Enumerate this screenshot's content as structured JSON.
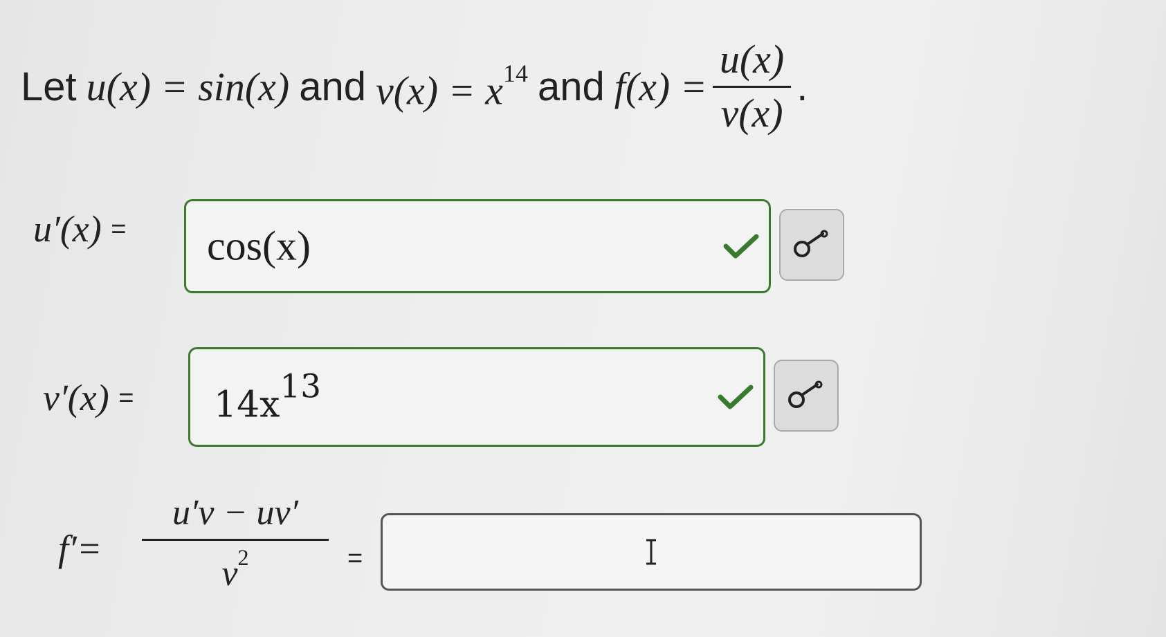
{
  "problem": {
    "let": "Let",
    "and1": "and",
    "and2": "and",
    "u_def": "u(x) = sin(x)",
    "v_def": "v(x) = x",
    "v_exponent": "14",
    "f_lhs": "f(x) =",
    "f_num": "u(x)",
    "f_den": "v(x)",
    "period": "."
  },
  "rows": {
    "u_prime": {
      "label": "u′(x)",
      "equals": "=",
      "value": "cos(x)",
      "status": "correct"
    },
    "v_prime": {
      "label": "v′(x)",
      "equals": "=",
      "value_base": "14x",
      "value_exponent": "13",
      "status": "correct"
    },
    "f_prime": {
      "label": "f′=",
      "num": "u′v − uv′",
      "den_base": "v",
      "den_exponent": "2",
      "equals": "=",
      "value": ""
    }
  },
  "icons": {
    "check": "check-icon",
    "key": "key-icon",
    "cursor": "text-cursor-icon"
  },
  "colors": {
    "correct": "#3a7a2e",
    "button_bg": "#dcdcdc"
  }
}
